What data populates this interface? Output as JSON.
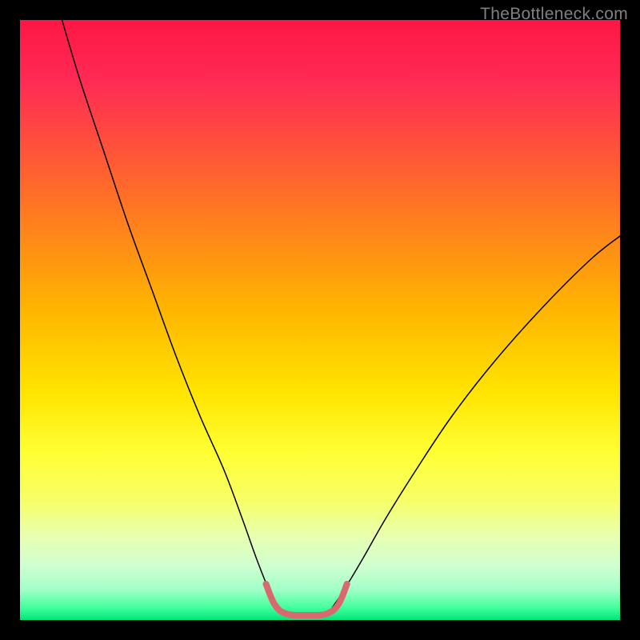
{
  "watermark": "TheBottleneck.com",
  "chart_data": {
    "type": "line",
    "title": "",
    "xlabel": "",
    "ylabel": "",
    "xlim": [
      0,
      100
    ],
    "ylim": [
      0,
      100
    ],
    "background_gradient": {
      "stops": [
        {
          "offset": 0.0,
          "color": "#ff1744"
        },
        {
          "offset": 0.1,
          "color": "#ff2a55"
        },
        {
          "offset": 0.28,
          "color": "#ff6a2a"
        },
        {
          "offset": 0.48,
          "color": "#ffb400"
        },
        {
          "offset": 0.62,
          "color": "#ffe400"
        },
        {
          "offset": 0.72,
          "color": "#ffff33"
        },
        {
          "offset": 0.8,
          "color": "#f7ff66"
        },
        {
          "offset": 0.86,
          "color": "#e8ffb0"
        },
        {
          "offset": 0.91,
          "color": "#d0ffd0"
        },
        {
          "offset": 0.95,
          "color": "#a0ffc8"
        },
        {
          "offset": 0.98,
          "color": "#40ff9a"
        },
        {
          "offset": 1.0,
          "color": "#00e57a"
        }
      ]
    },
    "series": [
      {
        "name": "left-curve",
        "color": "#000000",
        "width": 1.5,
        "points": [
          {
            "x": 7,
            "y": 100
          },
          {
            "x": 10,
            "y": 90
          },
          {
            "x": 14,
            "y": 78
          },
          {
            "x": 18,
            "y": 66
          },
          {
            "x": 22,
            "y": 55
          },
          {
            "x": 26,
            "y": 44
          },
          {
            "x": 30,
            "y": 34
          },
          {
            "x": 34,
            "y": 25
          },
          {
            "x": 37,
            "y": 17
          },
          {
            "x": 39.5,
            "y": 10
          },
          {
            "x": 41.5,
            "y": 5
          },
          {
            "x": 43,
            "y": 2
          }
        ]
      },
      {
        "name": "right-curve",
        "color": "#000000",
        "width": 1.5,
        "points": [
          {
            "x": 52,
            "y": 2
          },
          {
            "x": 54,
            "y": 5
          },
          {
            "x": 57,
            "y": 10
          },
          {
            "x": 61,
            "y": 17
          },
          {
            "x": 66,
            "y": 25
          },
          {
            "x": 72,
            "y": 34
          },
          {
            "x": 79,
            "y": 43
          },
          {
            "x": 87,
            "y": 52
          },
          {
            "x": 95,
            "y": 60
          },
          {
            "x": 100,
            "y": 64
          }
        ]
      },
      {
        "name": "trough-highlight",
        "color": "#d86a6f",
        "width": 8,
        "points": [
          {
            "x": 41,
            "y": 6
          },
          {
            "x": 42.5,
            "y": 2.5
          },
          {
            "x": 44.5,
            "y": 1
          },
          {
            "x": 48,
            "y": 0.8
          },
          {
            "x": 51,
            "y": 1
          },
          {
            "x": 53,
            "y": 2.5
          },
          {
            "x": 54.5,
            "y": 6
          }
        ]
      }
    ]
  }
}
